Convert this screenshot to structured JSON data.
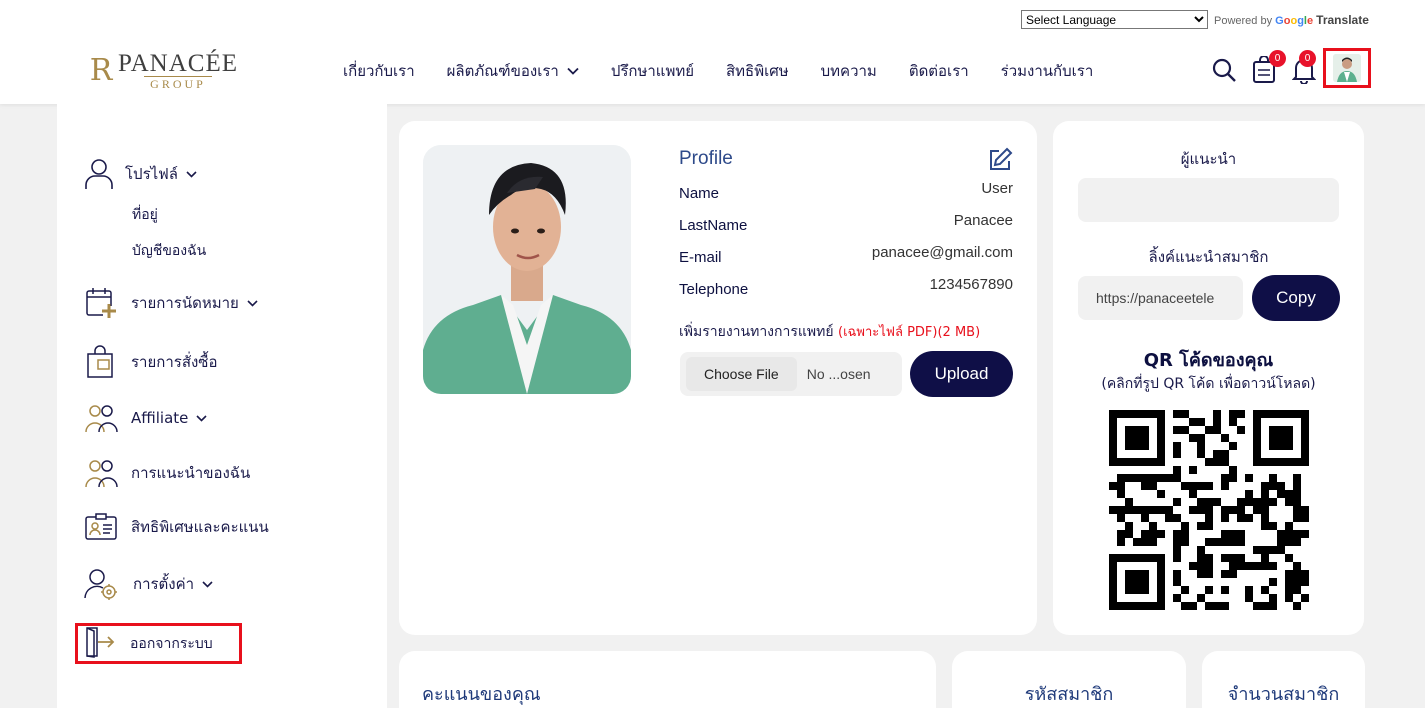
{
  "language": {
    "select_label": "Select Language",
    "powered_by": "Powered by",
    "translate": "Translate"
  },
  "logo": {
    "mark": "R",
    "brand": "PANACÉE",
    "sub": "GROUP"
  },
  "nav": {
    "items": [
      {
        "label": "เกี่ยวกับเรา"
      },
      {
        "label": "ผลิตภัณฑ์ของเรา",
        "dropdown": true
      },
      {
        "label": "ปรึกษาแพทย์"
      },
      {
        "label": "สิทธิพิเศษ"
      },
      {
        "label": "บทความ"
      },
      {
        "label": "ติดต่อเรา"
      },
      {
        "label": "ร่วมงานกับเรา"
      }
    ]
  },
  "header_icons": {
    "cart_count": "0",
    "notification_count": "0"
  },
  "sidebar": {
    "profile": "โปรไฟล์",
    "sub_address": "ที่อยู่",
    "sub_account": "บัญชีของฉัน",
    "appointments": "รายการนัดหมาย",
    "orders": "รายการสั่งซื้อ",
    "affiliate": "Affiliate",
    "my_referrals": "การแนะนำของฉัน",
    "privileges": "สิทธิพิเศษและคะแนน",
    "settings": "การตั้งค่า",
    "logout": "ออกจากระบบ"
  },
  "profile": {
    "title": "Profile",
    "name_label": "Name",
    "name_value": "User",
    "lastname_label": "LastName",
    "lastname_value": "Panacee",
    "email_label": "E-mail",
    "email_value": "panacee@gmail.com",
    "phone_label": "Telephone",
    "phone_value": "1234567890",
    "medical_report_label": "เพิ่มรายงานทางการแพทย์",
    "medical_report_note": "(เฉพาะไฟล์ PDF)(2 MB)",
    "choose_file": "Choose File",
    "file_status": "No ...osen",
    "upload": "Upload"
  },
  "referral": {
    "referrer_title": "ผู้แนะนำ",
    "referrer_value": "",
    "link_title": "ลิ้งค์แนะนำสมาชิก",
    "link_value": "https://panaceetele",
    "copy": "Copy",
    "qr_title": "QR โค้ดของคุณ",
    "qr_subtitle": "(คลิกที่รูป QR โค้ด เพื่อดาวน์โหลด)"
  },
  "bottom": {
    "points_title": "คะแนนของคุณ",
    "member_code_title": "รหัสสมาชิก",
    "member_count_title": "จำนวนสมาชิก"
  },
  "colors": {
    "primary": "#0f0f47",
    "accent_gold": "#a88a4a",
    "highlight_red": "#e8101c",
    "profile_title": "#2e4a8a"
  }
}
